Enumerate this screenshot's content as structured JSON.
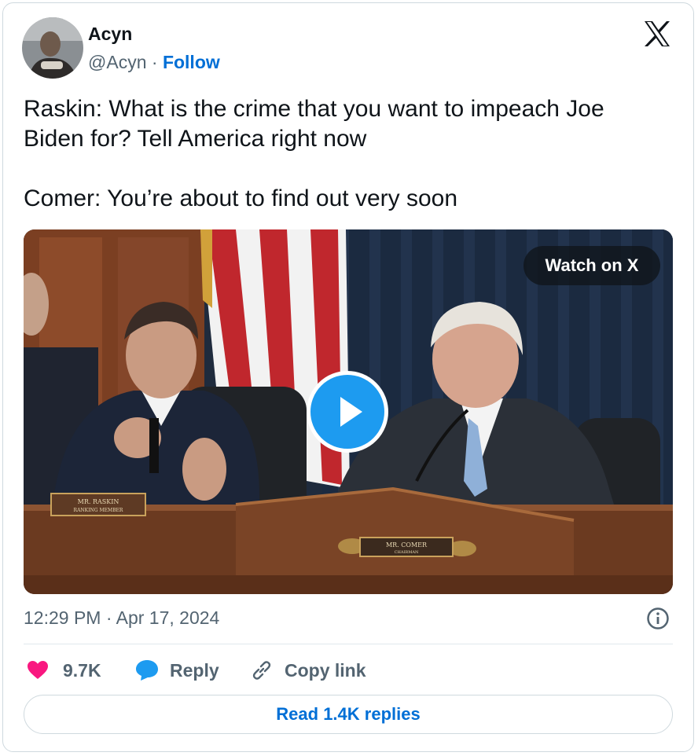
{
  "author": {
    "name": "Acyn",
    "handle": "@Acyn",
    "separator": " · ",
    "follow_label": "Follow"
  },
  "tweet": {
    "text": "Raskin: What is the crime that you want to impeach Joe Biden for? Tell America right now\n\nComer: You’re about to find out very soon"
  },
  "media": {
    "watch_label": "Watch on X",
    "nameplate_left_line1": "MR. RASKIN",
    "nameplate_left_line2": "RANKING MEMBER",
    "nameplate_right_line1": "MR. COMER",
    "nameplate_right_line2": "CHAIRMAN"
  },
  "meta": {
    "timestamp": "12:29 PM · Apr 17, 2024"
  },
  "actions": {
    "likes": "9.7K",
    "reply_label": "Reply",
    "copy_link_label": "Copy link",
    "read_replies_label": "Read 1.4K replies"
  },
  "colors": {
    "accent": "#006fd6",
    "like": "#f91880",
    "reply": "#1d9bf0",
    "secondary_text": "#536471"
  },
  "icons": [
    "x-logo-icon",
    "info-icon",
    "heart-icon",
    "reply-bubble-icon",
    "link-icon",
    "play-icon"
  ]
}
